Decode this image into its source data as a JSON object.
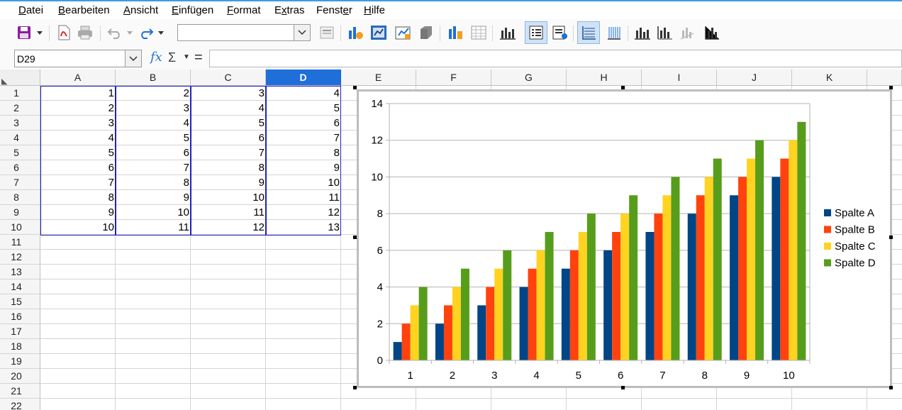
{
  "menu": [
    "Datei",
    "Bearbeiten",
    "Ansicht",
    "Einfügen",
    "Format",
    "Extras",
    "Fenster",
    "Hilfe"
  ],
  "menu_mnemonic_index": [
    0,
    0,
    0,
    0,
    0,
    1,
    5,
    0
  ],
  "toolbar_icons": [
    "save-icon",
    "dropdown-arrow-icon",
    "export-pdf-icon",
    "print-icon",
    "undo-icon",
    "dropdown-arrow-icon",
    "redo-icon",
    "dropdown-arrow-icon",
    "chart-element-combo",
    "format-selection-icon",
    "chart-type-icon",
    "chart-area-icon",
    "data-table-icon",
    "3d-view-icon",
    "data-ranges-icon",
    "data-table-grid-icon",
    "title-icon",
    "legend-on-off-icon",
    "legend-format-icon",
    "horizontal-grids-icon",
    "vertical-grids-icon",
    "x-axis-icon",
    "y-axis-icon",
    "z-axis-icon",
    "all-axes-icon"
  ],
  "namebox": {
    "value": "D29"
  },
  "formula": {
    "fx": "fx",
    "sigma": "Σ",
    "equals": "=",
    "value": ""
  },
  "columns": [
    "A",
    "B",
    "C",
    "D",
    "E",
    "F",
    "G",
    "H",
    "I",
    "J",
    "K"
  ],
  "selected_column": "D",
  "rows": [
    "1",
    "2",
    "3",
    "4",
    "5",
    "6",
    "7",
    "8",
    "9",
    "10",
    "11",
    "12",
    "13",
    "14",
    "15",
    "16",
    "17",
    "18",
    "19",
    "20",
    "21",
    "22"
  ],
  "cells": [
    [
      "1",
      "2",
      "3",
      "4"
    ],
    [
      "2",
      "3",
      "4",
      "5"
    ],
    [
      "3",
      "4",
      "5",
      "6"
    ],
    [
      "4",
      "5",
      "6",
      "7"
    ],
    [
      "5",
      "6",
      "7",
      "8"
    ],
    [
      "6",
      "7",
      "8",
      "9"
    ],
    [
      "7",
      "8",
      "9",
      "10"
    ],
    [
      "8",
      "9",
      "10",
      "11"
    ],
    [
      "9",
      "10",
      "11",
      "12"
    ],
    [
      "10",
      "11",
      "12",
      "13"
    ]
  ],
  "chart_data": {
    "type": "bar",
    "categories": [
      "1",
      "2",
      "3",
      "4",
      "5",
      "6",
      "7",
      "8",
      "9",
      "10"
    ],
    "series": [
      {
        "name": "Spalte A",
        "color": "#004586",
        "values": [
          1,
          2,
          3,
          4,
          5,
          6,
          7,
          8,
          9,
          10
        ]
      },
      {
        "name": "Spalte B",
        "color": "#ff420e",
        "values": [
          2,
          3,
          4,
          5,
          6,
          7,
          8,
          9,
          10,
          11
        ]
      },
      {
        "name": "Spalte C",
        "color": "#ffd320",
        "values": [
          3,
          4,
          5,
          6,
          7,
          8,
          9,
          10,
          11,
          12
        ]
      },
      {
        "name": "Spalte D",
        "color": "#579d1c",
        "values": [
          4,
          5,
          6,
          7,
          8,
          9,
          10,
          11,
          12,
          13
        ]
      }
    ],
    "ylim": [
      0,
      14
    ],
    "yticks": [
      0,
      2,
      4,
      6,
      8,
      10,
      12,
      14
    ],
    "grid": "horizontal",
    "legend": "right",
    "title": "",
    "xlabel": "",
    "ylabel": ""
  }
}
